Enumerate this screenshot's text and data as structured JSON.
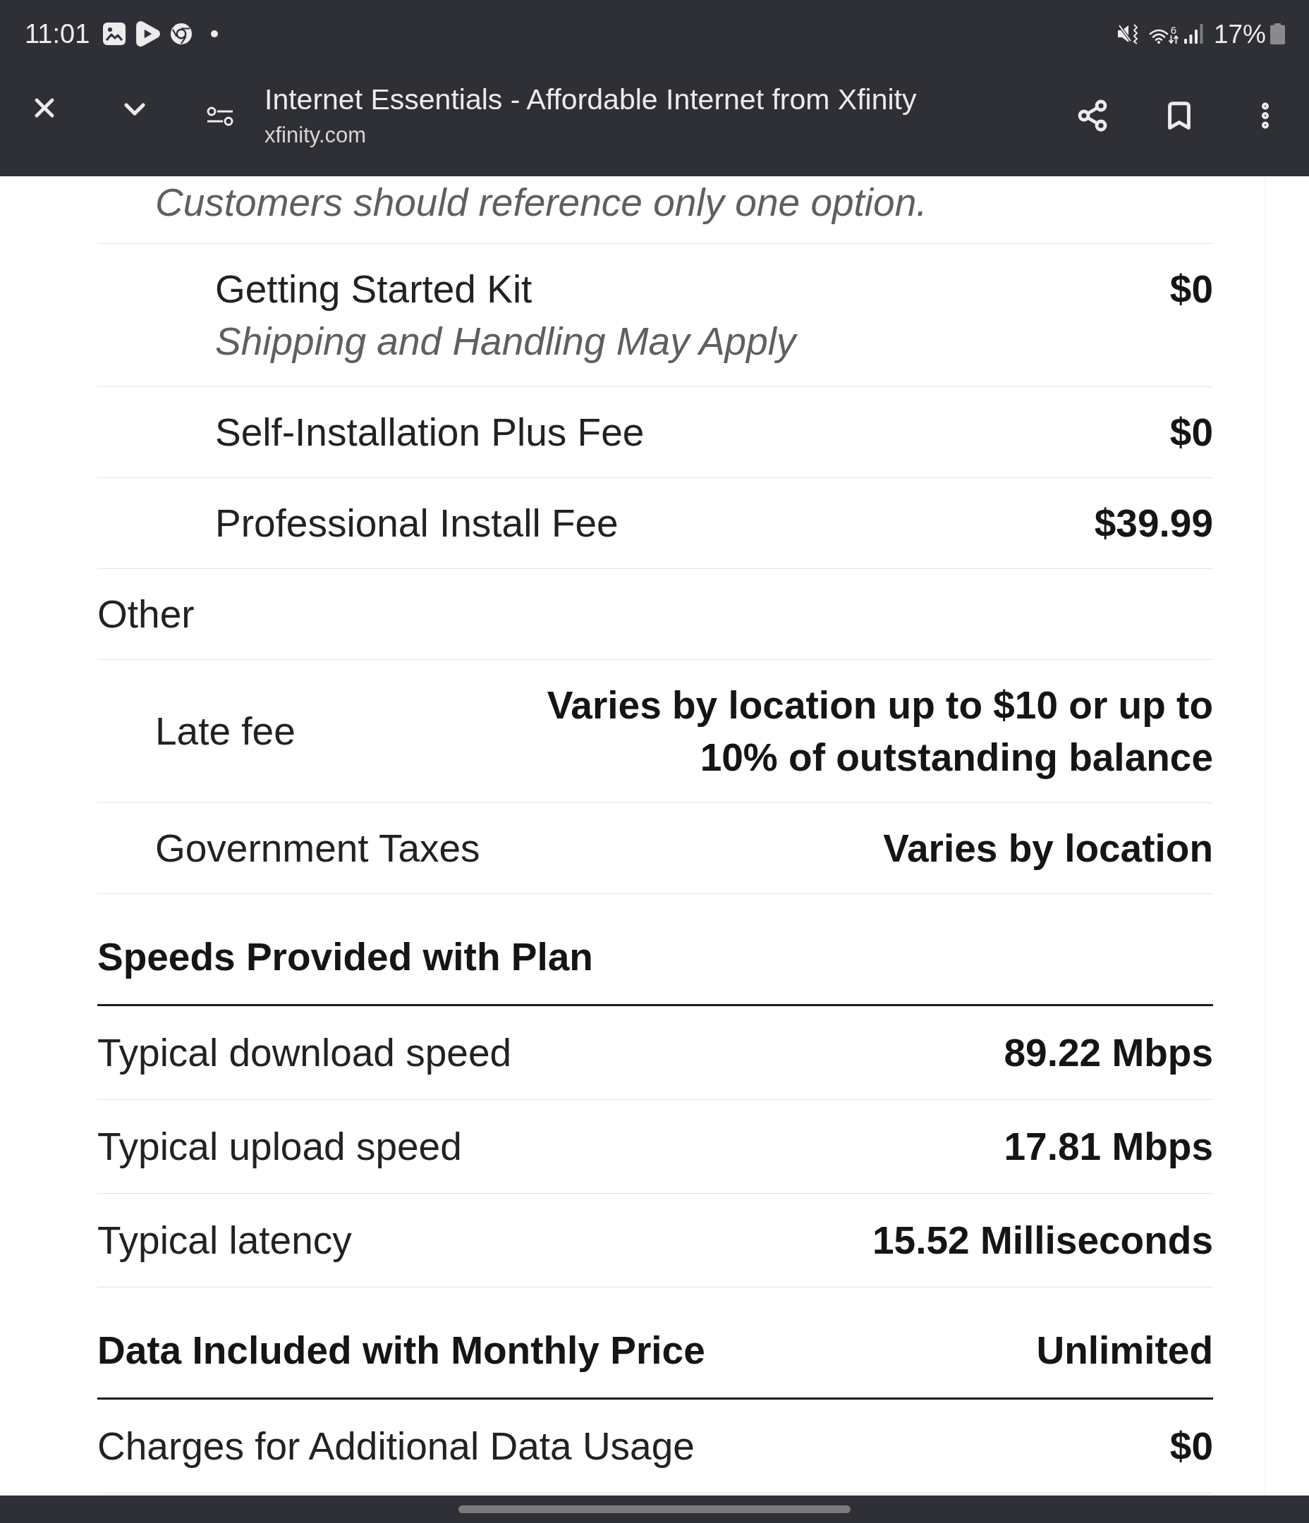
{
  "status_bar": {
    "time": "11:01",
    "wifi_label": "6",
    "battery": "17%"
  },
  "browser_bar": {
    "title": "Internet Essentials - Affordable Internet from Xfinity",
    "url": "xfinity.com"
  },
  "fees": [
    {
      "children": [
        {
          "note": "Customers should reference only one option.",
          "children": [
            {
              "label": "Getting Started Kit",
              "sublabel": "Shipping and Handling May Apply",
              "value": "$0"
            },
            {
              "label": "Self-Installation Plus Fee",
              "value": "$0"
            },
            {
              "label": "Professional Install Fee",
              "value": "$39.99"
            }
          ]
        }
      ]
    },
    {
      "label": "Other",
      "children": [
        {
          "label": "Late fee",
          "value": "Varies by location up to $10 or up to 10% of outstanding balance"
        },
        {
          "label": "Government Taxes",
          "value": "Varies by location"
        }
      ]
    }
  ],
  "sections": [
    {
      "heading": "Speeds Provided with Plan",
      "rows": [
        {
          "label": "Typical download speed",
          "value": "89.22 Mbps"
        },
        {
          "label": "Typical upload speed",
          "value": "17.81 Mbps"
        },
        {
          "label": "Typical latency",
          "value": "15.52 Milliseconds"
        }
      ]
    },
    {
      "heading": "Data Included with Monthly Price",
      "value": "Unlimited",
      "rows": [
        {
          "label": "Charges for Additional Data Usage",
          "value": "$0"
        }
      ]
    }
  ]
}
